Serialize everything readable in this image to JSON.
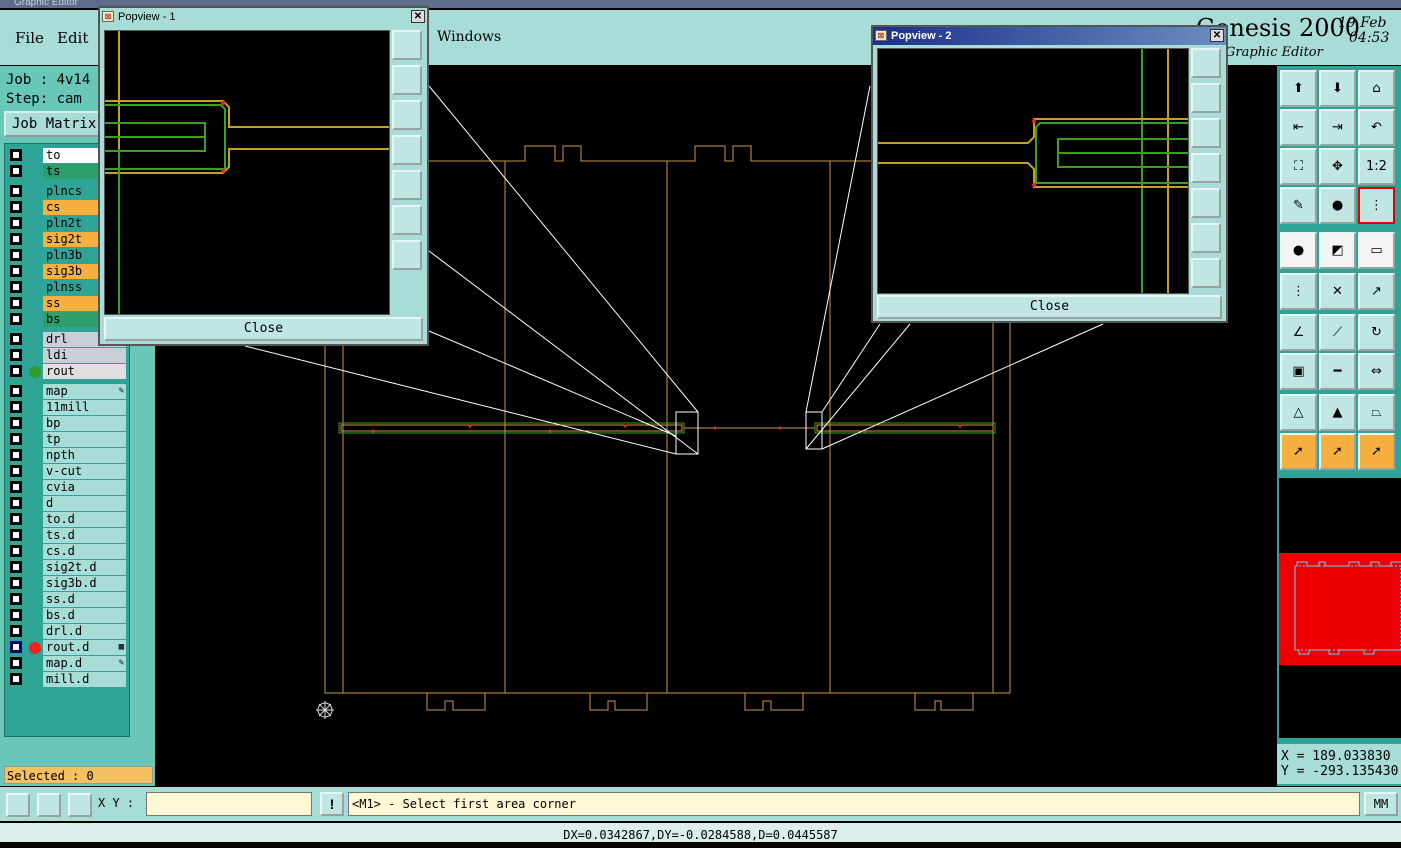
{
  "app": {
    "title": "Graphic Editor",
    "brand": "Genesis 2000",
    "brand_sub": "Graphic Editor",
    "date_line1": "19 Feb",
    "date_line2": "04:53"
  },
  "menu": {
    "file": "File",
    "edit": "Edit",
    "windows": "Windows"
  },
  "job": {
    "job_label": "Job : 4v14",
    "step_label": "Step: cam",
    "matrix_button": "Job Matrix"
  },
  "layers": [
    {
      "name": "to",
      "bg": "#ffffff"
    },
    {
      "name": "ts",
      "bg": "#2e9e6a"
    },
    {
      "name": "plncs",
      "bg": "#2ea496"
    },
    {
      "name": "cs",
      "bg": "#f5b040"
    },
    {
      "name": "pln2t",
      "bg": "#2ea496"
    },
    {
      "name": "sig2t",
      "bg": "#f5b040"
    },
    {
      "name": "pln3b",
      "bg": "#2ea496"
    },
    {
      "name": "sig3b",
      "bg": "#f5b040"
    },
    {
      "name": "plnss",
      "bg": "#2ea496"
    },
    {
      "name": "ss",
      "bg": "#f5b040"
    },
    {
      "name": "bs",
      "bg": "#2e9e6a"
    },
    {
      "name": "drl",
      "bg": "#c8d0d6"
    },
    {
      "name": "ldi",
      "bg": "#c8d0d6"
    },
    {
      "name": "rout",
      "bg": "#e0e0e0",
      "dot": "#2e9c2e"
    },
    {
      "name": "map",
      "bg": "#a8dcd6",
      "mark": "✎"
    },
    {
      "name": "11mill",
      "bg": "#a8dcd6"
    },
    {
      "name": "bp",
      "bg": "#a8dcd6"
    },
    {
      "name": "tp",
      "bg": "#a8dcd6"
    },
    {
      "name": "npth",
      "bg": "#a8dcd6"
    },
    {
      "name": "v-cut",
      "bg": "#a8dcd6"
    },
    {
      "name": "cvia",
      "bg": "#a8dcd6"
    },
    {
      "name": "d",
      "bg": "#a8dcd6"
    },
    {
      "name": "to.d",
      "bg": "#a8dcd6"
    },
    {
      "name": "ts.d",
      "bg": "#a8dcd6"
    },
    {
      "name": "cs.d",
      "bg": "#a8dcd6"
    },
    {
      "name": "sig2t.d",
      "bg": "#a8dcd6"
    },
    {
      "name": "sig3b.d",
      "bg": "#a8dcd6"
    },
    {
      "name": "ss.d",
      "bg": "#a8dcd6"
    },
    {
      "name": "bs.d",
      "bg": "#a8dcd6"
    },
    {
      "name": "drl.d",
      "bg": "#a8dcd6"
    },
    {
      "name": "rout.d",
      "bg": "#a8dcd6",
      "dot": "#ee2020",
      "selected": true,
      "mark": "▦"
    },
    {
      "name": "map.d",
      "bg": "#a8dcd6",
      "mark": "✎"
    },
    {
      "name": "mill.d",
      "bg": "#a8dcd6"
    }
  ],
  "selected": "Selected : 0",
  "popview1": {
    "title": "Popview - 1",
    "close": "Close"
  },
  "popview2": {
    "title": "Popview - 2",
    "close": "Close"
  },
  "tools": {
    "ratio_label": "1:2"
  },
  "coords": {
    "x": "X = 189.033830",
    "y": "Y = -293.135430"
  },
  "bottom": {
    "xy_label": "X Y :",
    "xy_value": "",
    "warn": "!",
    "prompt": "<M1> - Select first area corner",
    "units": "MM"
  },
  "status": "DX=0.0342867,DY=-0.0284588,D=0.0445587",
  "colors": {
    "panel": "#69c7b8",
    "menubar": "#a8dcd6",
    "board_outline": "#c8944a",
    "trace_orange": "#c8a020",
    "trace_green": "#3aa020",
    "minimap_red": "#ee0000"
  }
}
